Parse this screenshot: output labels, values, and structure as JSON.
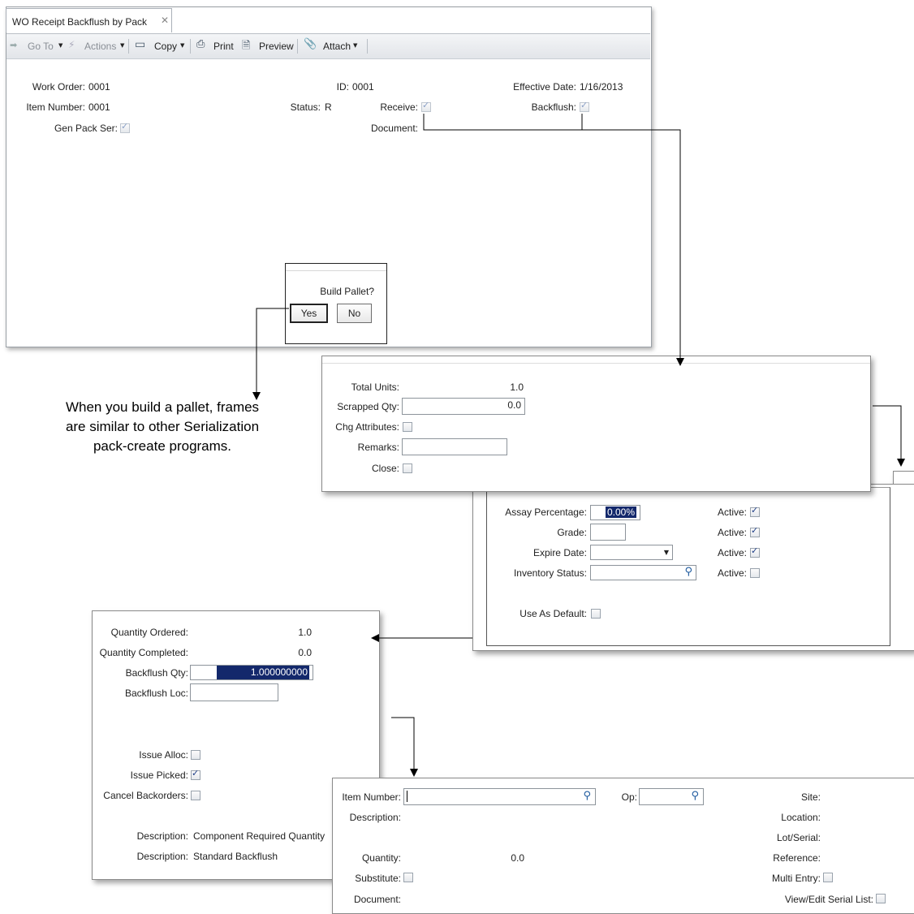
{
  "main": {
    "tab_title": "WO Receipt Backflush by Pack",
    "toolbar": {
      "goto": "Go To",
      "actions": "Actions",
      "copy": "Copy",
      "print": "Print",
      "preview": "Preview",
      "attach": "Attach"
    },
    "fields": {
      "work_order_label": "Work Order:",
      "work_order": "0001",
      "id_label": "ID:",
      "id": "0001",
      "effective_date_label": "Effective Date:",
      "effective_date": "1/16/2013",
      "item_number_label": "Item Number:",
      "item_number": "0001",
      "status_label": "Status:",
      "status": "R",
      "receive_label": "Receive:",
      "backflush_label": "Backflush:",
      "gen_pack_ser_label": "Gen Pack Ser:",
      "document_label": "Document:"
    }
  },
  "dialog": {
    "question": "Build Pallet?",
    "yes": "Yes",
    "no": "No"
  },
  "annotation": {
    "line1": "When you build a pallet, frames",
    "line2": "are similar to other Serialization",
    "line3": "pack-create programs."
  },
  "units_frame": {
    "total_units_label": "Total Units:",
    "total_units": "1.0",
    "scrapped_qty_label": "Scrapped Qty:",
    "scrapped_qty": "0.0",
    "chg_attributes_label": "Chg Attributes:",
    "remarks_label": "Remarks:",
    "close_label": "Close:"
  },
  "attributes_frame": {
    "assay_label": "Assay Percentage:",
    "assay": "0.00%",
    "grade_label": "Grade:",
    "expire_label": "Expire Date:",
    "inventory_status_label": "Inventory Status:",
    "active_label": "Active:",
    "use_default_label": "Use As Default:"
  },
  "backflush_frame": {
    "qty_ordered_label": "Quantity Ordered:",
    "qty_ordered": "1.0",
    "qty_completed_label": "Quantity Completed:",
    "qty_completed": "0.0",
    "backflush_qty_label": "Backflush Qty:",
    "backflush_qty": "1.000000000",
    "backflush_loc_label": "Backflush Loc:",
    "issue_alloc_label": "Issue Alloc:",
    "issue_picked_label": "Issue Picked:",
    "cancel_backorders_label": "Cancel Backorders:",
    "description_label": "Description:",
    "description1": "Component Required Quantity",
    "description2": "Standard Backflush"
  },
  "component_frame": {
    "item_number_label": "Item Number:",
    "op_label": "Op:",
    "site_label": "Site:",
    "description_label": "Description:",
    "location_label": "Location:",
    "lot_serial_label": "Lot/Serial:",
    "quantity_label": "Quantity:",
    "quantity": "0.0",
    "reference_label": "Reference:",
    "substitute_label": "Substitute:",
    "multi_entry_label": "Multi Entry:",
    "document_label": "Document:",
    "view_edit_label": "View/Edit Serial List:"
  }
}
